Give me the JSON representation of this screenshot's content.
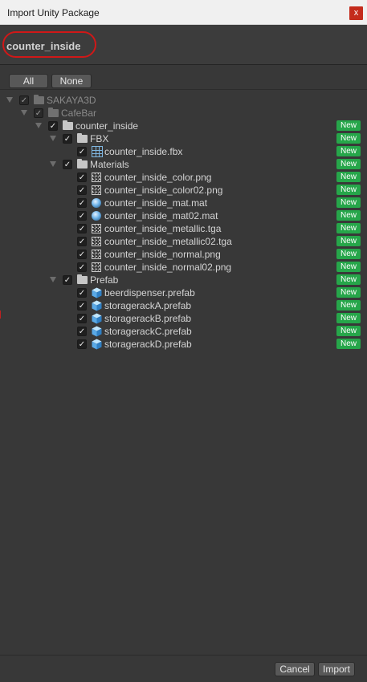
{
  "window": {
    "title": "Import Unity Package",
    "close_glyph": "x"
  },
  "header": {
    "package_name": "counter_inside"
  },
  "toolbar": {
    "all_label": "All",
    "none_label": "None"
  },
  "tree": {
    "new_badge": "New",
    "check_glyph": "✓",
    "rows": [
      {
        "label": "SAKAYA3D",
        "kind": "folder",
        "dim": true,
        "is_new": false
      },
      {
        "label": "CafeBar",
        "kind": "folder",
        "dim": true,
        "is_new": false
      },
      {
        "label": "counter_inside",
        "kind": "folder",
        "dim": false,
        "is_new": true
      },
      {
        "label": "FBX",
        "kind": "folder",
        "dim": false,
        "is_new": true
      },
      {
        "label": "counter_inside.fbx",
        "kind": "model",
        "dim": false,
        "is_new": true
      },
      {
        "label": "Materials",
        "kind": "folder",
        "dim": false,
        "is_new": true
      },
      {
        "label": "counter_inside_color.png",
        "kind": "image",
        "dim": false,
        "is_new": true
      },
      {
        "label": "counter_inside_color02.png",
        "kind": "image",
        "dim": false,
        "is_new": true
      },
      {
        "label": "counter_inside_mat.mat",
        "kind": "material",
        "dim": false,
        "is_new": true
      },
      {
        "label": "counter_inside_mat02.mat",
        "kind": "material",
        "dim": false,
        "is_new": true
      },
      {
        "label": "counter_inside_metallic.tga",
        "kind": "image",
        "dim": false,
        "is_new": true
      },
      {
        "label": "counter_inside_metallic02.tga",
        "kind": "image",
        "dim": false,
        "is_new": true
      },
      {
        "label": "counter_inside_normal.png",
        "kind": "image",
        "dim": false,
        "is_new": true
      },
      {
        "label": "counter_inside_normal02.png",
        "kind": "image",
        "dim": false,
        "is_new": true
      },
      {
        "label": "Prefab",
        "kind": "folder",
        "dim": false,
        "is_new": true
      },
      {
        "label": "beerdispenser.prefab",
        "kind": "prefab",
        "dim": false,
        "is_new": true
      },
      {
        "label": "storagerackA.prefab",
        "kind": "prefab",
        "dim": false,
        "is_new": true
      },
      {
        "label": "storagerackB.prefab",
        "kind": "prefab",
        "dim": false,
        "is_new": true
      },
      {
        "label": "storagerackC.prefab",
        "kind": "prefab",
        "dim": false,
        "is_new": true
      },
      {
        "label": "storagerackD.prefab",
        "kind": "prefab",
        "dim": false,
        "is_new": true
      }
    ]
  },
  "footer": {
    "cancel_label": "Cancel",
    "import_label": "Import"
  },
  "colors": {
    "new_badge": "#26a64a",
    "highlight": "#d01818",
    "close": "#c42b1c"
  }
}
